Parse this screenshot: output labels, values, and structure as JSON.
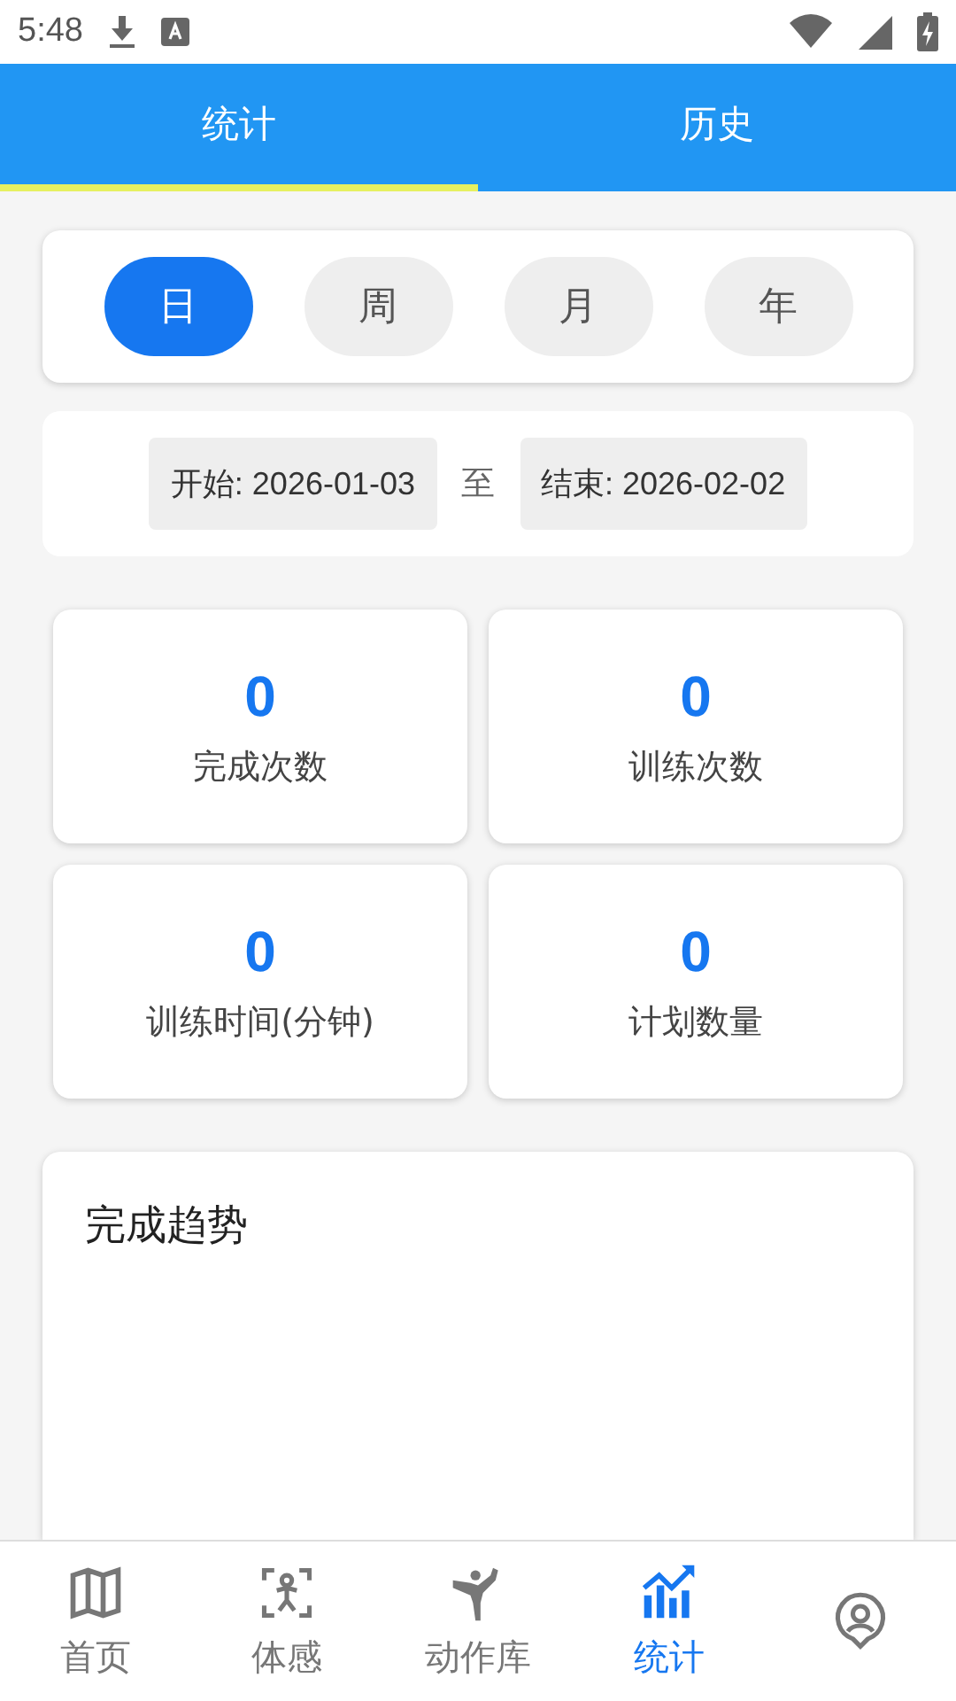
{
  "status_bar": {
    "time": "5:48"
  },
  "tabs": [
    {
      "label": "统计",
      "selected": true
    },
    {
      "label": "历史",
      "selected": false
    }
  ],
  "periods": [
    {
      "label": "日",
      "selected": true
    },
    {
      "label": "周",
      "selected": false
    },
    {
      "label": "月",
      "selected": false
    },
    {
      "label": "年",
      "selected": false
    }
  ],
  "date_range": {
    "start": "开始: 2026-01-03",
    "separator": "至",
    "end": "结束: 2026-02-02"
  },
  "stats": [
    {
      "value": "0",
      "label": "完成次数"
    },
    {
      "value": "0",
      "label": "训练次数"
    },
    {
      "value": "0",
      "label": "训练时间(分钟)"
    },
    {
      "value": "0",
      "label": "计划数量"
    }
  ],
  "trend": {
    "title": "完成趋势"
  },
  "bottom_nav": [
    {
      "kind": "map",
      "label": "首页",
      "selected": false
    },
    {
      "kind": "body",
      "label": "体感",
      "selected": false
    },
    {
      "kind": "pose",
      "label": "动作库",
      "selected": false
    },
    {
      "kind": "chart",
      "label": "统计",
      "selected": true
    },
    {
      "kind": "profile",
      "selected": false
    }
  ]
}
